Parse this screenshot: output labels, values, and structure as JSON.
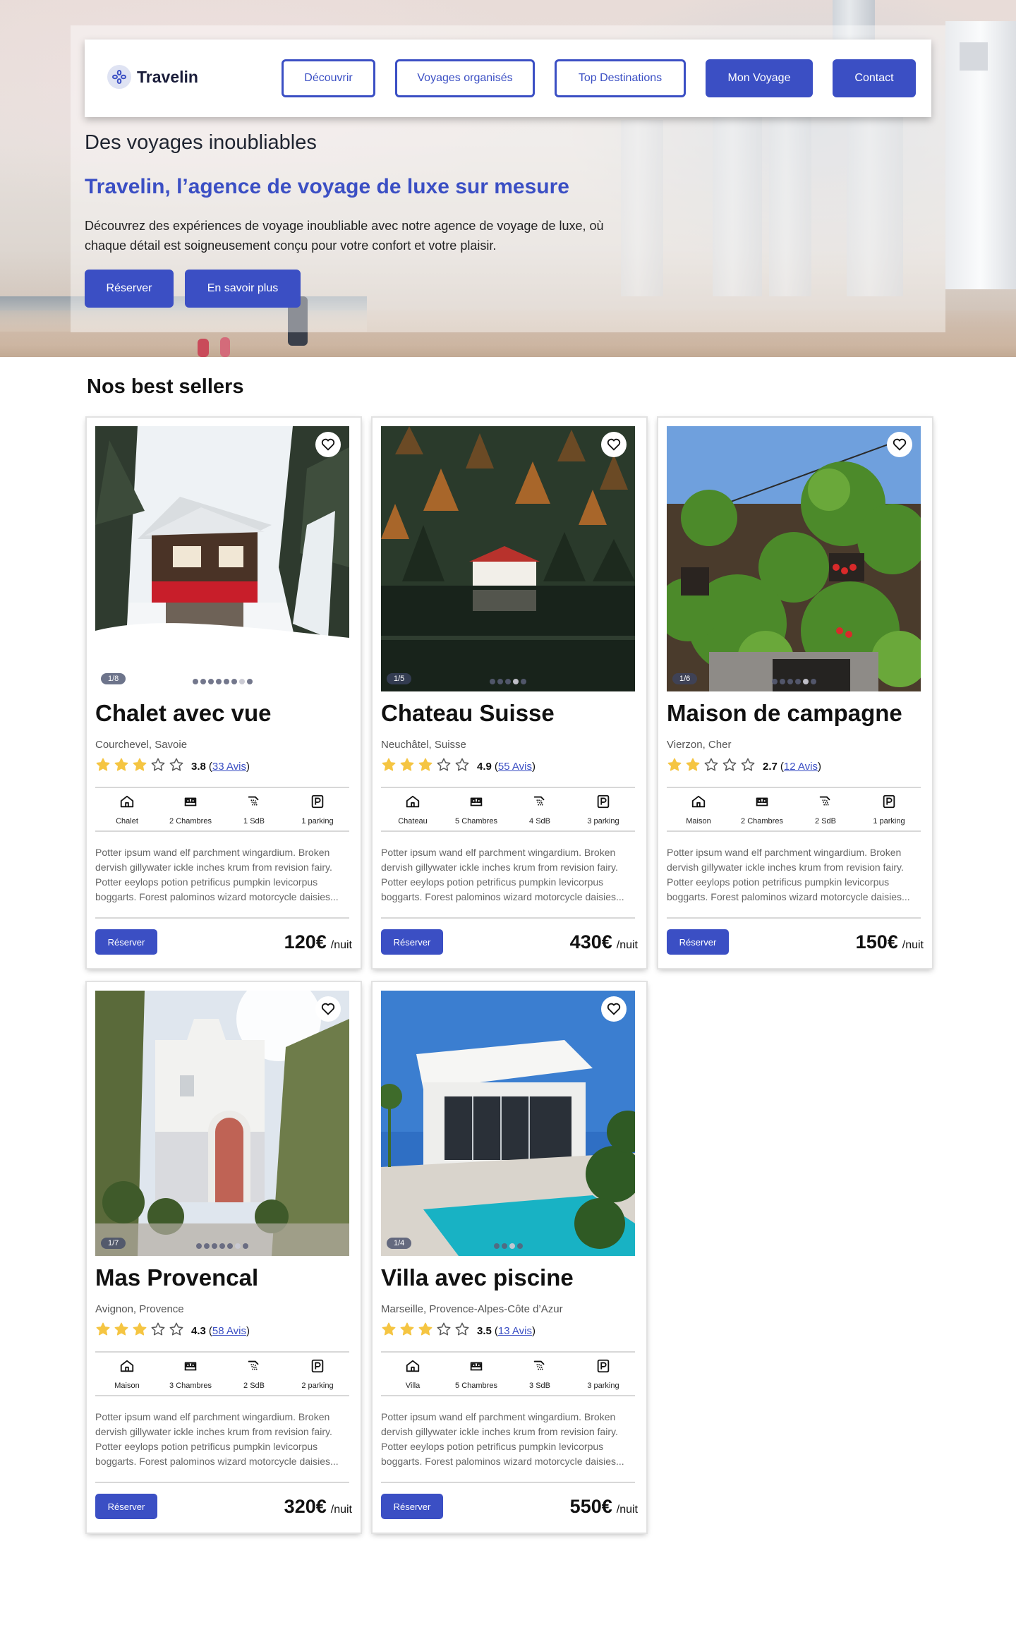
{
  "brand": {
    "name": "Travelin"
  },
  "nav": {
    "items": [
      {
        "label": "Découvrir",
        "filled": false
      },
      {
        "label": "Voyages organisés",
        "filled": false
      },
      {
        "label": "Top Destinations",
        "filled": false
      },
      {
        "label": "Mon Voyage",
        "filled": true
      },
      {
        "label": "Contact",
        "filled": true
      }
    ]
  },
  "hero": {
    "eyebrow": "Des voyages inoubliables",
    "title": "Travelin, l’agence de voyage de luxe sur mesure",
    "description": "Découvrez des expériences de voyage inoubliable avec notre agence de voyage de luxe, où chaque détail est soigneusement conçu pour votre confort et votre plaisir.",
    "primary_button": "Réserver",
    "secondary_button": "En savoir plus"
  },
  "section": {
    "title": "Nos best sellers"
  },
  "colors": {
    "accent": "#3b4fc4",
    "star": "#f5c542",
    "text": "#111111"
  },
  "listings": [
    {
      "title": "Chalet avec vue",
      "location": "Courchevel, Savoie",
      "rating": 3.8,
      "rating_text": "3.8",
      "reviews": "33 Avis",
      "stars_filled": 3,
      "counter": "1/8",
      "image_count": 8,
      "features": [
        {
          "icon": "house-icon",
          "label": "Chalet"
        },
        {
          "icon": "bed-icon",
          "label": "2 Chambres"
        },
        {
          "icon": "shower-icon",
          "label": "1 SdB"
        },
        {
          "icon": "parking-icon",
          "label": "1 parking"
        }
      ],
      "description": "Potter ipsum wand elf parchment wingardium. Broken dervish gillywater ickle inches krum from revision fairy. Potter eeylops potion petrificus pumpkin levicorpus boggarts. Forest palominos wizard motorcycle daisies...",
      "button": "Réserver",
      "price": "120€",
      "price_unit": "/nuit",
      "photo": "chalet"
    },
    {
      "title": "Chateau Suisse",
      "location": "Neuchâtel, Suisse",
      "rating": 4.9,
      "rating_text": "4.9",
      "reviews": "55 Avis",
      "stars_filled": 3,
      "counter": "1/5",
      "image_count": 5,
      "features": [
        {
          "icon": "house-icon",
          "label": "Chateau"
        },
        {
          "icon": "bed-icon",
          "label": "5 Chambres"
        },
        {
          "icon": "shower-icon",
          "label": "4 SdB"
        },
        {
          "icon": "parking-icon",
          "label": "3 parking"
        }
      ],
      "description": "Potter ipsum wand elf parchment wingardium. Broken dervish gillywater ickle inches krum from revision fairy. Potter eeylops potion petrificus pumpkin levicorpus boggarts. Forest palominos wizard motorcycle daisies...",
      "button": "Réserver",
      "price": "430€",
      "price_unit": "/nuit",
      "photo": "lake"
    },
    {
      "title": "Maison de campagne",
      "location": "Vierzon, Cher",
      "rating": 2.7,
      "rating_text": "2.7",
      "reviews": "12 Avis",
      "stars_filled": 2,
      "counter": "1/6",
      "image_count": 6,
      "features": [
        {
          "icon": "house-icon",
          "label": "Maison"
        },
        {
          "icon": "bed-icon",
          "label": "2 Chambres"
        },
        {
          "icon": "shower-icon",
          "label": "2 SdB"
        },
        {
          "icon": "parking-icon",
          "label": "1 parking"
        }
      ],
      "description": "Potter ipsum wand elf parchment wingardium. Broken dervish gillywater ickle inches krum from revision fairy. Potter eeylops potion petrificus pumpkin levicorpus boggarts. Forest palominos wizard motorcycle daisies...",
      "button": "Réserver",
      "price": "150€",
      "price_unit": "/nuit",
      "photo": "ivy"
    },
    {
      "title": "Mas Provencal",
      "location": "Avignon, Provence",
      "rating": 4.3,
      "rating_text": "4.3",
      "reviews": "58 Avis",
      "stars_filled": 3,
      "counter": "1/7",
      "image_count": 7,
      "features": [
        {
          "icon": "house-icon",
          "label": "Maison"
        },
        {
          "icon": "bed-icon",
          "label": "3 Chambres"
        },
        {
          "icon": "shower-icon",
          "label": "2 SdB"
        },
        {
          "icon": "parking-icon",
          "label": "2 parking"
        }
      ],
      "description": "Potter ipsum wand elf parchment wingardium. Broken dervish gillywater ickle inches krum from revision fairy. Potter eeylops potion petrificus pumpkin levicorpus boggarts. Forest palominos wizard motorcycle daisies...",
      "button": "Réserver",
      "price": "320€",
      "price_unit": "/nuit",
      "photo": "mas"
    },
    {
      "title": "Villa avec piscine",
      "location": "Marseille, Provence-Alpes-Côte d’Azur",
      "rating": 3.5,
      "rating_text": "3.5",
      "reviews": "13 Avis",
      "stars_filled": 3,
      "counter": "1/4",
      "image_count": 4,
      "features": [
        {
          "icon": "house-icon",
          "label": "Villa"
        },
        {
          "icon": "bed-icon",
          "label": "5 Chambres"
        },
        {
          "icon": "shower-icon",
          "label": "3 SdB"
        },
        {
          "icon": "parking-icon",
          "label": "3 parking"
        }
      ],
      "description": "Potter ipsum wand elf parchment wingardium. Broken dervish gillywater ickle inches krum from revision fairy. Potter eeylops potion petrificus pumpkin levicorpus boggarts. Forest palominos wizard motorcycle daisies...",
      "button": "Réserver",
      "price": "550€",
      "price_unit": "/nuit",
      "photo": "villa"
    }
  ]
}
